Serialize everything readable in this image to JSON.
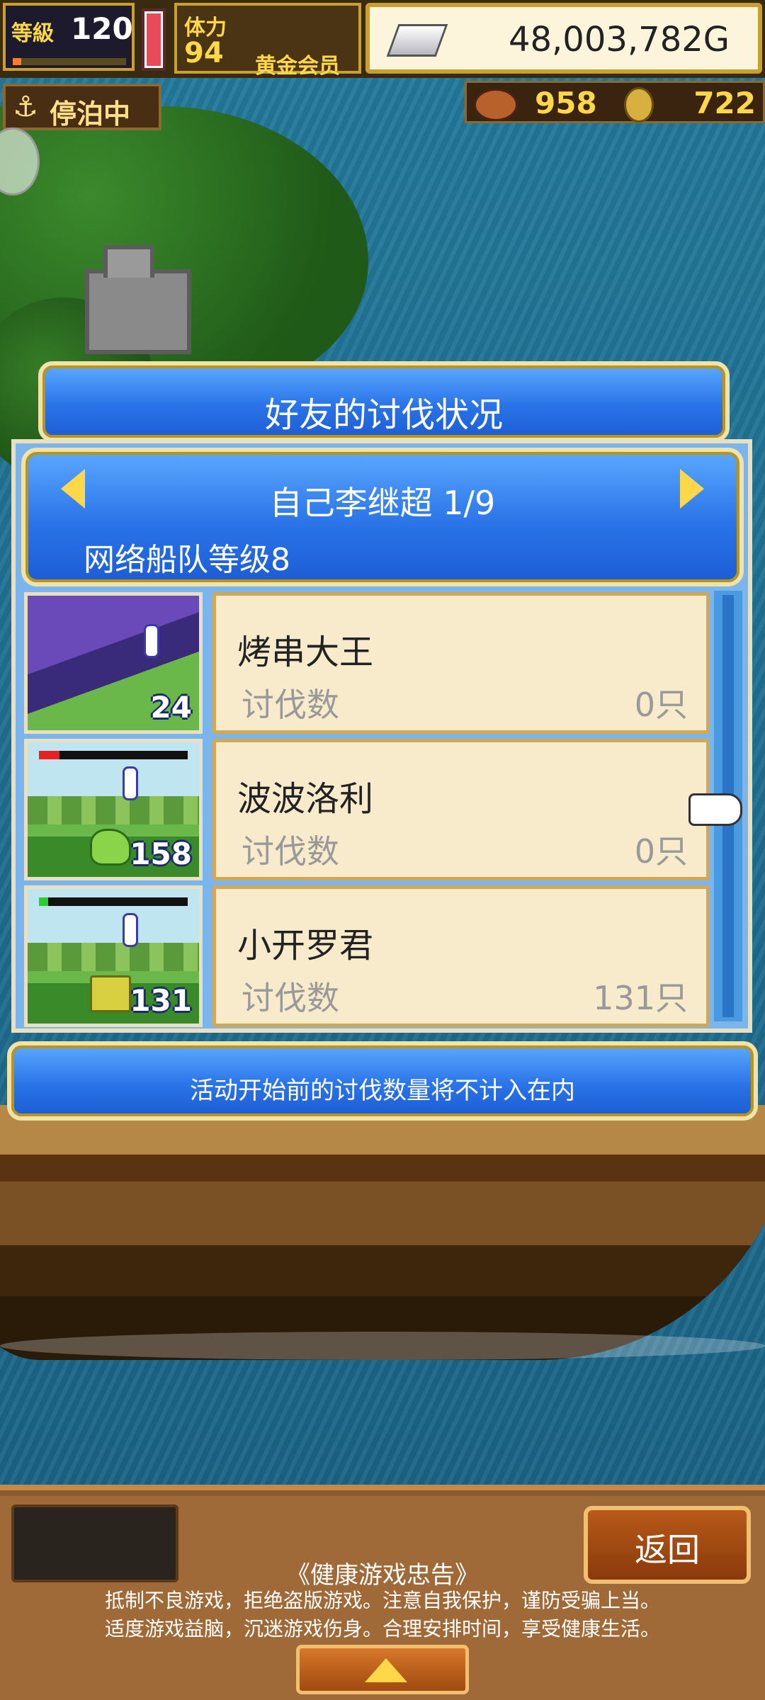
{
  "hud": {
    "level_label": "等級",
    "level": "120",
    "stamina_label": "体力",
    "stamina": "94",
    "membership": "黄金会员",
    "gold": "48,003,782G",
    "status": "停泊中",
    "resource1": "958",
    "resource2": "722"
  },
  "dialog": {
    "title": "好友的讨伐状况",
    "friend_name": "自己李继超 1/9",
    "fleet_level": "网络船队等级8",
    "rows": [
      {
        "name": "烤串大王",
        "label": "讨伐数",
        "count": "0只",
        "thumb_level": "24"
      },
      {
        "name": "波波洛利",
        "label": "讨伐数",
        "count": "0只",
        "thumb_level": "158"
      },
      {
        "name": "小开罗君",
        "label": "讨伐数",
        "count": "131只",
        "thumb_level": "131"
      }
    ],
    "notice": "活动开始前的讨伐数量将不计入在内"
  },
  "bottom": {
    "back_label": "返回",
    "advisory_title": "《健康游戏忠告》",
    "advisory_line1": "抵制不良游戏，拒绝盗版游戏。注意自我保护，谨防受骗上当。",
    "advisory_line2": "适度游戏益脑，沉迷游戏伤身。合理安排时间，享受健康生活。"
  },
  "colors": {
    "panel_blue": "#2a74e8",
    "card_bg": "#f8ebcb",
    "gold_text": "#ffd84a",
    "hp_red": "#e82020",
    "hp_green": "#2ad02a"
  }
}
